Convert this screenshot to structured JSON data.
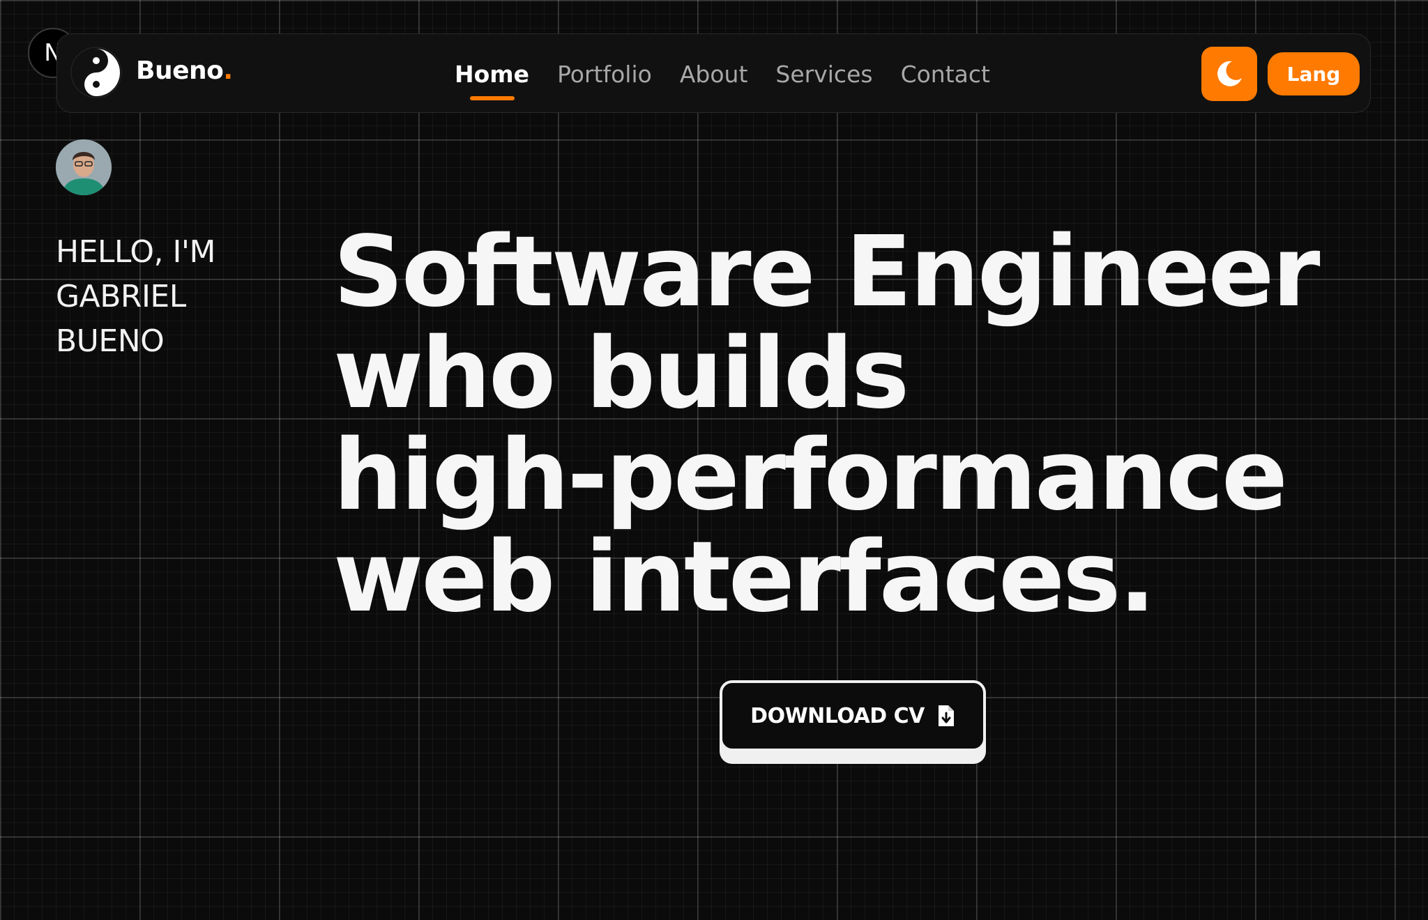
{
  "brand": {
    "name": "Bueno",
    "dot": ".",
    "accent_color": "#ff7a00",
    "logo_icon": "yin-yang-logo"
  },
  "nav": {
    "links": [
      {
        "label": "Home",
        "active": true
      },
      {
        "label": "Portfolio",
        "active": false
      },
      {
        "label": "About",
        "active": false
      },
      {
        "label": "Services",
        "active": false
      },
      {
        "label": "Contact",
        "active": false
      }
    ],
    "theme_toggle_icon": "moon-icon",
    "lang_label": "Lang"
  },
  "badge": {
    "letter": "N"
  },
  "hero": {
    "greeting_lines": [
      "HELLO, I'M",
      "GABRIEL",
      "BUENO"
    ],
    "headline_lines": [
      "Software Engineer",
      "who builds",
      "high-performance",
      "web interfaces."
    ],
    "cta_label": "DOWNLOAD CV",
    "cta_icon": "file-download-icon"
  }
}
